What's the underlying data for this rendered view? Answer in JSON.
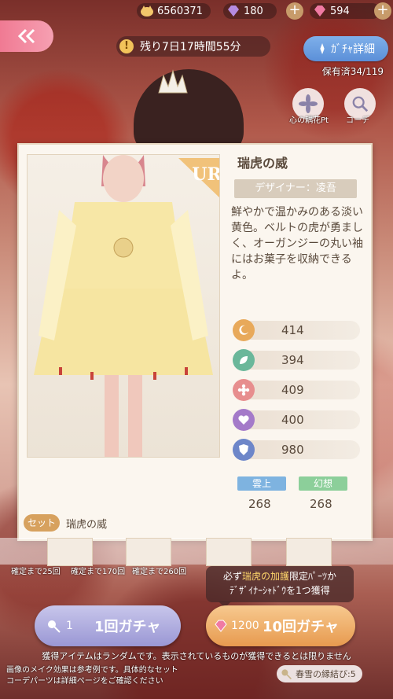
{
  "currencies": {
    "coins": "6560371",
    "purple_gems": "180",
    "pink_gems": "594"
  },
  "timer": {
    "text": "残り7日17時間55分"
  },
  "gacha_detail": {
    "label": "ｶﾞﾁｬ詳細"
  },
  "owned": "保有済34/119",
  "side_buttons": {
    "flower_points": "心の耦花Pt",
    "coordinate": "コーデ"
  },
  "item": {
    "rarity": "UR",
    "name": "瑞虎の威",
    "designer": "デザイナー：凌吾",
    "description": "鮮やかで温かみのある淡い黄色。ベルトの虎が勇ましく、オーガンジーの丸い袖にはお菓子を収納できるよ。",
    "stats": [
      "414",
      "394",
      "409",
      "400",
      "980"
    ],
    "tags": [
      {
        "label": "雲上",
        "value": "268"
      },
      {
        "label": "幻想",
        "value": "268"
      }
    ],
    "set_badge": "セット",
    "set_name": "瑞虎の威"
  },
  "guarantees": [
    "確定まで25回",
    "確定まで170回",
    "確定まで260回"
  ],
  "bonus": {
    "line1_prefix": "必ず",
    "line1_highlight": "瑞虎の加護",
    "line1_suffix": "限定ﾊﾟｰﾂか",
    "line2": "ﾃﾞｻﾞｲﾅｰｼｬﾄﾞｳを1つ獲得"
  },
  "gacha_single": {
    "cost": "1",
    "label": "1回ガチャ"
  },
  "gacha_ten": {
    "cost": "1200",
    "label": "10回ガチャ"
  },
  "notice": "獲得アイテムはランダムです。表示されているものが獲得できるとは限りません",
  "note_lines": [
    "画像のメイク効果は参考例です。具体的なセット",
    "コーデパーツは詳細ページをご確認ください"
  ],
  "fate_ticket": "春雪の縁結び:5",
  "colors": {
    "stat_icons": [
      "#e8a95a",
      "#6ab79a",
      "#e78e8e",
      "#a47ac9",
      "#6d86c9"
    ],
    "tag_colors": [
      "#7eb3e0",
      "#8ccf9a"
    ]
  }
}
